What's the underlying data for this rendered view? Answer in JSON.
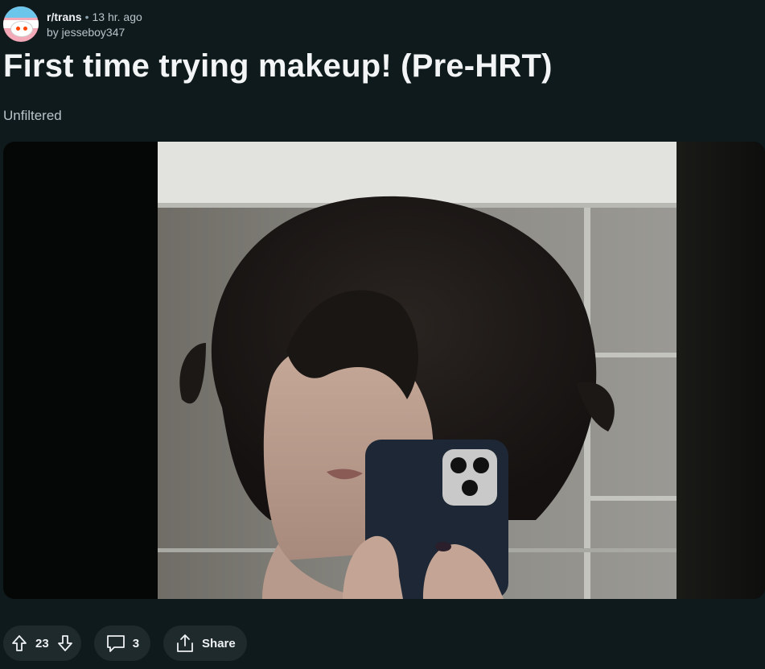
{
  "post": {
    "subreddit": "r/trans",
    "separator": "•",
    "time_ago": "13 hr. ago",
    "author": "by jesseboy347",
    "title": "First time trying makeup! (Pre-HRT)",
    "flair": "Unfiltered"
  },
  "media": {
    "description_icon": "photo",
    "colors": {
      "wall": "#8c8c86",
      "tile_grout": "#c9c9c4",
      "ceiling": "#e4e4e0",
      "hair": "#1b1715",
      "skin": "#b89a8c",
      "phone_case": "#1d2736"
    }
  },
  "actions": {
    "upvote_icon": "arrow-up-icon",
    "vote_count": "23",
    "downvote_icon": "arrow-down-icon",
    "comment_icon": "comment-icon",
    "comment_count": "3",
    "share_icon": "share-icon",
    "share_label": "Share"
  },
  "theme": {
    "background": "#0f1a1c",
    "pill_background": "#1f2a2d",
    "text": "#eef1f3",
    "muted_text": "#b7c4c9"
  }
}
